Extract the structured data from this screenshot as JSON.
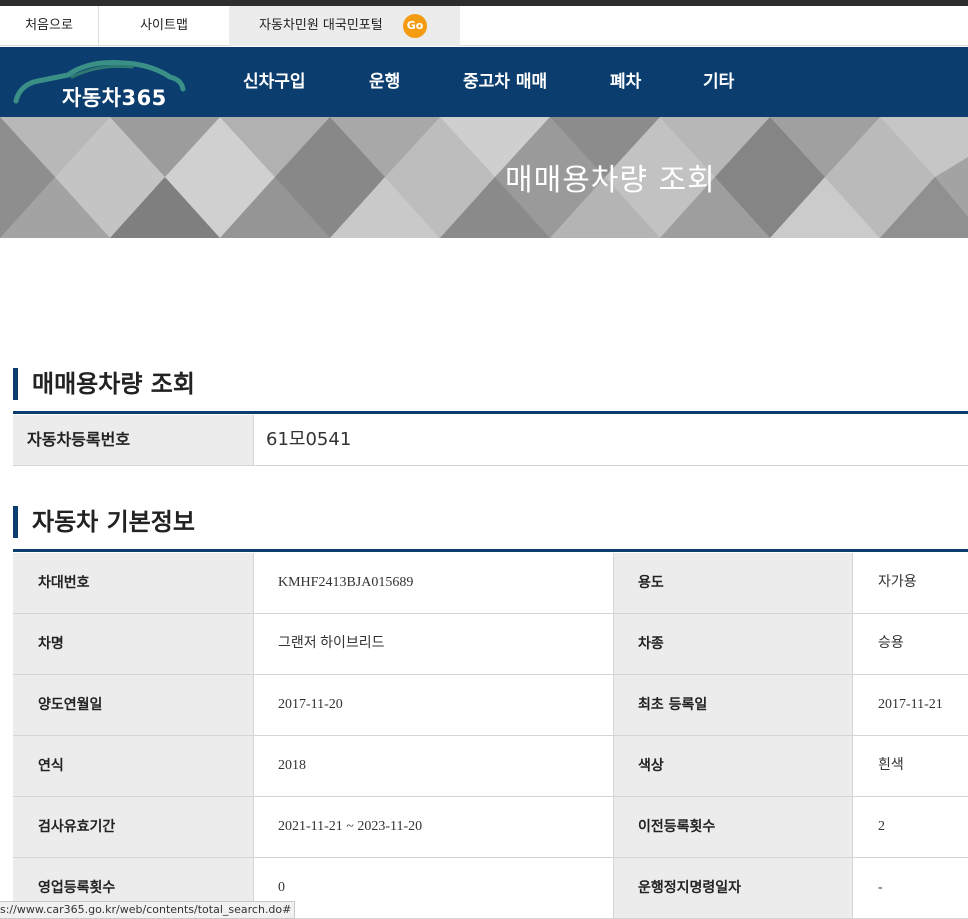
{
  "utility": {
    "home": "처음으로",
    "sitemap": "사이트맵",
    "portal": "자동차민원 대국민포털",
    "go_badge": "Go"
  },
  "header": {
    "logo_text": "자동차365",
    "nav": [
      "신차구입",
      "운행",
      "중고차 매매",
      "폐차",
      "기타"
    ]
  },
  "banner": {
    "title": "매매용차량 조회"
  },
  "search_section": {
    "title": "매매용차량 조회",
    "label": "자동차등록번호",
    "value": "61모0541"
  },
  "info_section": {
    "title": "자동차 기본정보",
    "rows": [
      {
        "label1": "차대번호",
        "value1": "KMHF2413BJA015689",
        "label2": "용도",
        "value2": "자가용"
      },
      {
        "label1": "차명",
        "value1": "그랜저 하이브리드",
        "label2": "차종",
        "value2": "승용"
      },
      {
        "label1": "양도연월일",
        "value1": "2017-11-20",
        "label2": "최초 등록일",
        "value2": "2017-11-21"
      },
      {
        "label1": "연식",
        "value1": "2018",
        "label2": "색상",
        "value2": "흰색"
      },
      {
        "label1": "검사유효기간",
        "value1": "2021-11-21 ~ 2023-11-20",
        "label2": "이전등록횟수",
        "value2": "2"
      },
      {
        "label1": "영업등록횟수",
        "value1": "0",
        "label2": "운행정지명령일자",
        "value2": "-"
      }
    ]
  },
  "status_bar": "s://www.car365.go.kr/web/contents/total_search.do#",
  "colors": {
    "brand_navy": "#0b3e6e",
    "go_orange": "#f39c12",
    "logo_teal": "#3a8f86"
  }
}
